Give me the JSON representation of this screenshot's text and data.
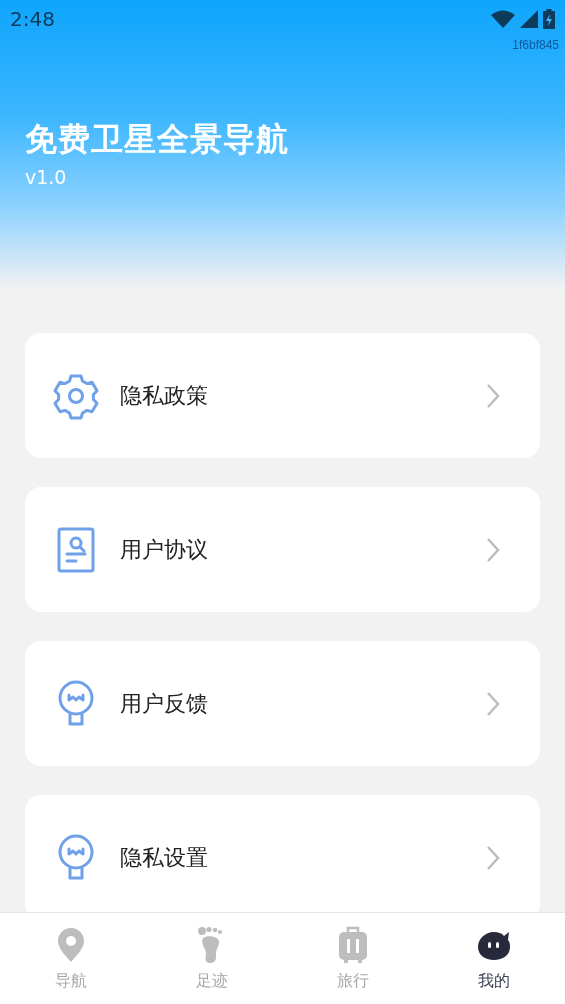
{
  "status_bar": {
    "time": "2:48"
  },
  "build_id": "1f6bf845",
  "header": {
    "title": "免费卫星全景导航",
    "version": "v1.0"
  },
  "menu_items": [
    {
      "kind": "gear",
      "label": "隐私政策"
    },
    {
      "kind": "document",
      "label": "用户协议"
    },
    {
      "kind": "bulb",
      "label": "用户反馈"
    },
    {
      "kind": "bulb",
      "label": "隐私设置"
    }
  ],
  "tabs": [
    {
      "kind": "pin",
      "label": "导航",
      "selected": false
    },
    {
      "kind": "foot",
      "label": "足迹",
      "selected": false
    },
    {
      "kind": "luggage",
      "label": "旅行",
      "selected": false
    },
    {
      "kind": "face",
      "label": "我的",
      "selected": true
    }
  ]
}
